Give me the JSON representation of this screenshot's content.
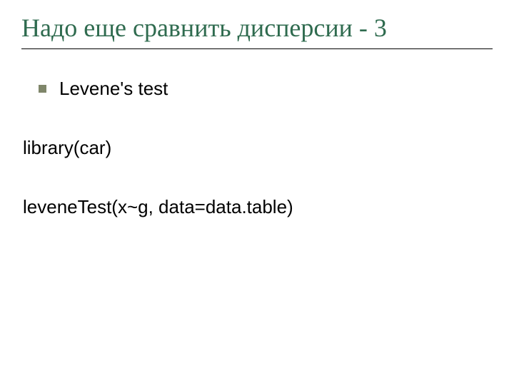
{
  "title": "Надо еще сравнить дисперсии - 3",
  "bullet_items": [
    "Levene's test"
  ],
  "lines": [
    "library(car)",
    "leveneTest(x~g, data=data.table)"
  ]
}
